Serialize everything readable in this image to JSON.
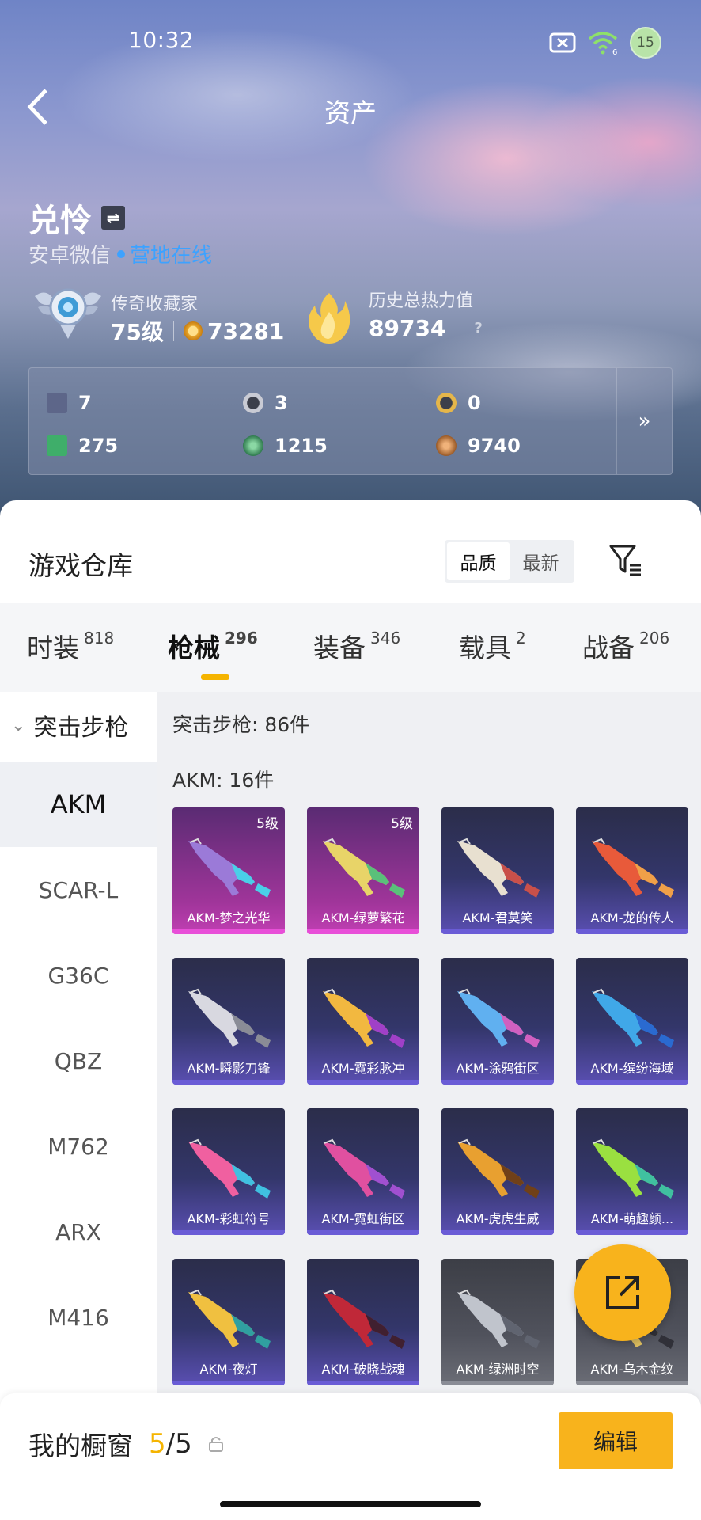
{
  "status": {
    "time": "10:32",
    "battery": "15",
    "signal": "6"
  },
  "header": {
    "title": "资产"
  },
  "profile": {
    "name": "兑怜",
    "switch_icon": "⇌",
    "platform": "安卓微信",
    "online": "营地在线",
    "rank_title": "传奇收藏家",
    "rank_level": "75级",
    "coins": "73281",
    "heat_title": "历史总热力值",
    "heat_value": "89734",
    "help": "?"
  },
  "stats": [
    {
      "icon": "card-icon",
      "value": "7",
      "color": "#7a83a3"
    },
    {
      "icon": "silver-coin-icon",
      "value": "3",
      "color": "#c9cbd4"
    },
    {
      "icon": "gold-token-icon",
      "value": "0",
      "color": "#e5b64a"
    },
    {
      "icon": "green-card-icon",
      "value": "275",
      "color": "#3fae6a"
    },
    {
      "icon": "green-orb-icon",
      "value": "1215",
      "color": "#49a36b"
    },
    {
      "icon": "bronze-coin-icon",
      "value": "9740",
      "color": "#c27a3c"
    }
  ],
  "stats_more": "»",
  "warehouse": {
    "title": "游戏仓库",
    "sort": [
      "品质",
      "最新"
    ],
    "tabs": [
      {
        "label": "时装",
        "count": "818"
      },
      {
        "label": "枪械",
        "count": "296"
      },
      {
        "label": "装备",
        "count": "346"
      },
      {
        "label": "载具",
        "count": "2"
      },
      {
        "label": "战备",
        "count": "206"
      }
    ],
    "category": "突击步枪",
    "weapons": [
      "AKM",
      "SCAR-L",
      "G36C",
      "QBZ",
      "M762",
      "ARX",
      "M416"
    ],
    "category_count": "突击步枪: 86件",
    "sub_count": "AKM: 16件",
    "items": [
      {
        "name": "AKM-梦之光华",
        "level": "5级",
        "tier": "purple"
      },
      {
        "name": "AKM-绿萝繁花",
        "level": "5级",
        "tier": "purple"
      },
      {
        "name": "AKM-君莫笑",
        "level": "",
        "tier": "blue"
      },
      {
        "name": "AKM-龙的传人",
        "level": "",
        "tier": "blue"
      },
      {
        "name": "AKM-瞬影刀锋",
        "level": "",
        "tier": "blue"
      },
      {
        "name": "AKM-霓彩脉冲",
        "level": "",
        "tier": "blue"
      },
      {
        "name": "AKM-涂鸦街区",
        "level": "",
        "tier": "blue"
      },
      {
        "name": "AKM-缤纷海域",
        "level": "",
        "tier": "blue"
      },
      {
        "name": "AKM-彩虹符号",
        "level": "",
        "tier": "blue"
      },
      {
        "name": "AKM-霓虹街区",
        "level": "",
        "tier": "blue"
      },
      {
        "name": "AKM-虎虎生威",
        "level": "",
        "tier": "blue"
      },
      {
        "name": "AKM-萌趣颜...",
        "level": "",
        "tier": "blue"
      },
      {
        "name": "AKM-夜灯",
        "level": "",
        "tier": "blue"
      },
      {
        "name": "AKM-破晓战魂",
        "level": "",
        "tier": "blue"
      },
      {
        "name": "AKM-绿洲时空",
        "level": "",
        "tier": "grey"
      },
      {
        "name": "AKM-乌木金纹",
        "level": "",
        "tier": "grey"
      }
    ]
  },
  "showcase": {
    "label": "我的橱窗",
    "used": "5",
    "total": "/5",
    "edit": "编辑"
  }
}
